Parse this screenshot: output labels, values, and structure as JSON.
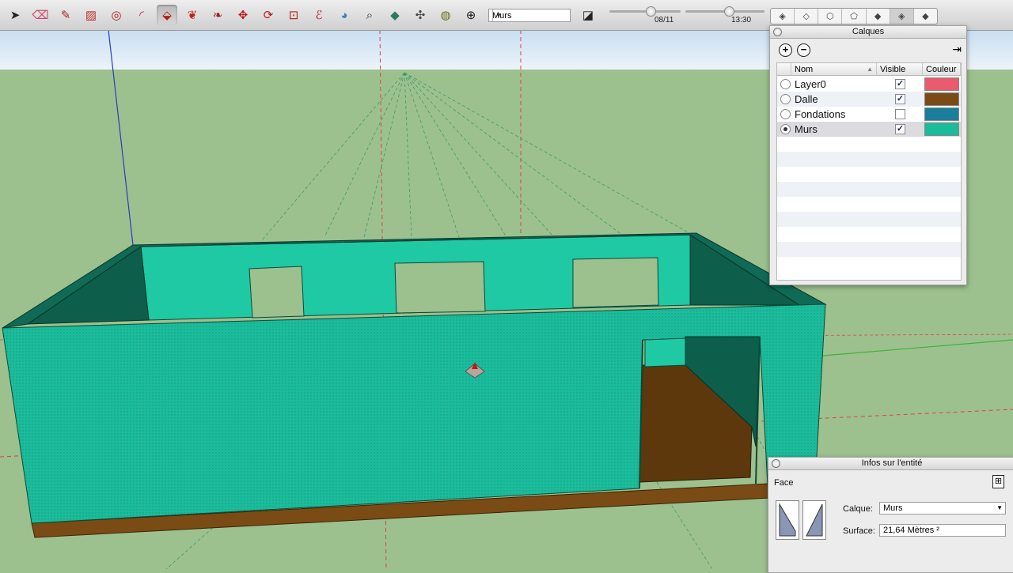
{
  "toolbar": {
    "tools": [
      {
        "icon": "select-arrow-icon",
        "glyph": "➤",
        "color": "#222222"
      },
      {
        "icon": "eraser-icon",
        "glyph": "⌫",
        "color": "#d0446a"
      },
      {
        "icon": "pencil-icon",
        "glyph": "✎",
        "color": "#b02020"
      },
      {
        "icon": "rectangle-icon",
        "glyph": "▨",
        "color": "#c03030"
      },
      {
        "icon": "circle-icon",
        "glyph": "◎",
        "color": "#b02020"
      },
      {
        "icon": "arc-icon",
        "glyph": "◜",
        "color": "#c02040"
      },
      {
        "icon": "push-pull-icon",
        "glyph": "⬙",
        "color": "#b02020"
      },
      {
        "icon": "follow-me-icon",
        "glyph": "❦",
        "color": "#c02020"
      },
      {
        "icon": "offset-icon",
        "glyph": "❧",
        "color": "#a02020"
      },
      {
        "icon": "move-icon",
        "glyph": "✥",
        "color": "#c01818"
      },
      {
        "icon": "rotate-icon",
        "glyph": "⟳",
        "color": "#c01818"
      },
      {
        "icon": "scale-icon",
        "glyph": "⊡",
        "color": "#b02020"
      },
      {
        "icon": "freehand-icon",
        "glyph": "ℰ",
        "color": "#c02020"
      },
      {
        "icon": "paint-bucket-icon",
        "glyph": "◕",
        "color": "#4080c0"
      },
      {
        "icon": "tape-measure-icon",
        "glyph": "⌕",
        "color": "#333333"
      },
      {
        "icon": "section-plane-icon",
        "glyph": "◆",
        "color": "#2a7a5a"
      },
      {
        "icon": "dimension-icon",
        "glyph": "✣",
        "color": "#444444"
      },
      {
        "icon": "texture-icon",
        "glyph": "◍",
        "color": "#6a6a20"
      },
      {
        "icon": "position-camera-icon",
        "glyph": "⊕",
        "color": "#222222"
      }
    ],
    "layer_select_value": "Murs",
    "eraser_icon_after_select": "◪",
    "date_slider_label": "08/11",
    "date_slider_value": 0.58,
    "time_slider_label": "13:30",
    "time_slider_value": 0.55,
    "styles": [
      {
        "icon": "xray-style-icon",
        "glyph": "◈"
      },
      {
        "icon": "back-edges-style-icon",
        "glyph": "◇"
      },
      {
        "icon": "wireframe-style-icon",
        "glyph": "⬡"
      },
      {
        "icon": "hidden-line-style-icon",
        "glyph": "⬠"
      },
      {
        "icon": "shaded-style-icon",
        "glyph": "◆"
      },
      {
        "icon": "shaded-textures-style-icon",
        "glyph": "◈"
      },
      {
        "icon": "monochrome-style-icon",
        "glyph": "◆"
      }
    ]
  },
  "layers_panel": {
    "title": "Calques",
    "add_label": "+",
    "remove_label": "−",
    "details_icon": "⇥",
    "columns": {
      "name": "Nom",
      "sort_arrow": "▲",
      "visible": "Visible",
      "color": "Couleur"
    },
    "layers": [
      {
        "name": "Layer0",
        "visible": true,
        "active": false,
        "color": "#e95b6e"
      },
      {
        "name": "Dalle",
        "visible": true,
        "active": false,
        "color": "#7a4b14"
      },
      {
        "name": "Fondations",
        "visible": false,
        "active": false,
        "color": "#1a7d9c"
      },
      {
        "name": "Murs",
        "visible": true,
        "active": true,
        "color": "#1bbc9b"
      }
    ]
  },
  "entity_panel": {
    "title": "Infos sur l'entité",
    "type": "Face",
    "layer_label": "Calque:",
    "layer_value": "Murs",
    "surface_label": "Surface:",
    "surface_value": "21,64 Mètres ²",
    "details_icon": "⊞"
  },
  "scene": {
    "wall_color": "#1bbc9b",
    "wall_dark": "#0d5e4a",
    "slab_color": "#7a4b14",
    "sky_color": "#e3eef8",
    "ground_color": "#9dc08f"
  }
}
